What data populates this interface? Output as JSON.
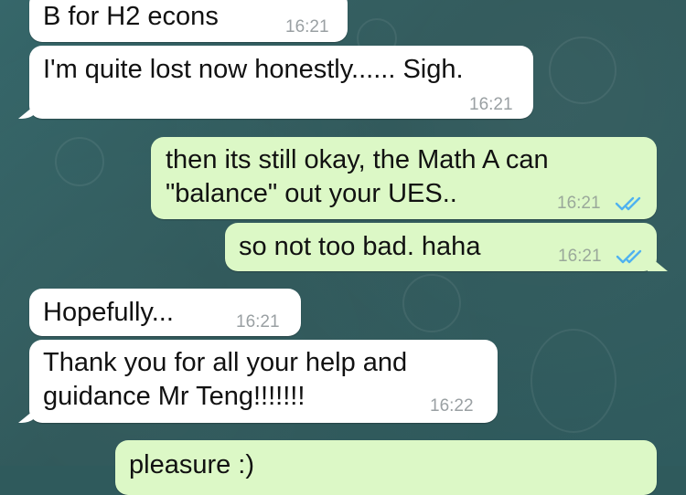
{
  "colors": {
    "incoming_bubble": "#ffffff",
    "outgoing_bubble": "#dcf8c6",
    "read_ticks": "#4fb2f0",
    "wallpaper": "#2f5a5c"
  },
  "messages": [
    {
      "direction": "incoming",
      "lines": [
        "B for H2 econs"
      ],
      "time": "16:21"
    },
    {
      "direction": "incoming",
      "lines": [
        "I'm quite lost now honestly...... Sigh."
      ],
      "time": "16:21"
    },
    {
      "direction": "outgoing",
      "lines": [
        "then its still okay, the Math A can",
        "\"balance\" out your UES.."
      ],
      "time": "16:21",
      "status": "read-double-tick-icon"
    },
    {
      "direction": "outgoing",
      "lines": [
        "so not too bad. haha"
      ],
      "time": "16:21",
      "status": "read-double-tick-icon"
    },
    {
      "direction": "incoming",
      "lines": [
        "Hopefully..."
      ],
      "time": "16:21"
    },
    {
      "direction": "incoming",
      "lines": [
        "Thank you for all your help and",
        "guidance Mr Teng!!!!!!!"
      ],
      "time": "16:22"
    },
    {
      "direction": "outgoing",
      "lines": [
        "pleasure :)"
      ]
    }
  ]
}
